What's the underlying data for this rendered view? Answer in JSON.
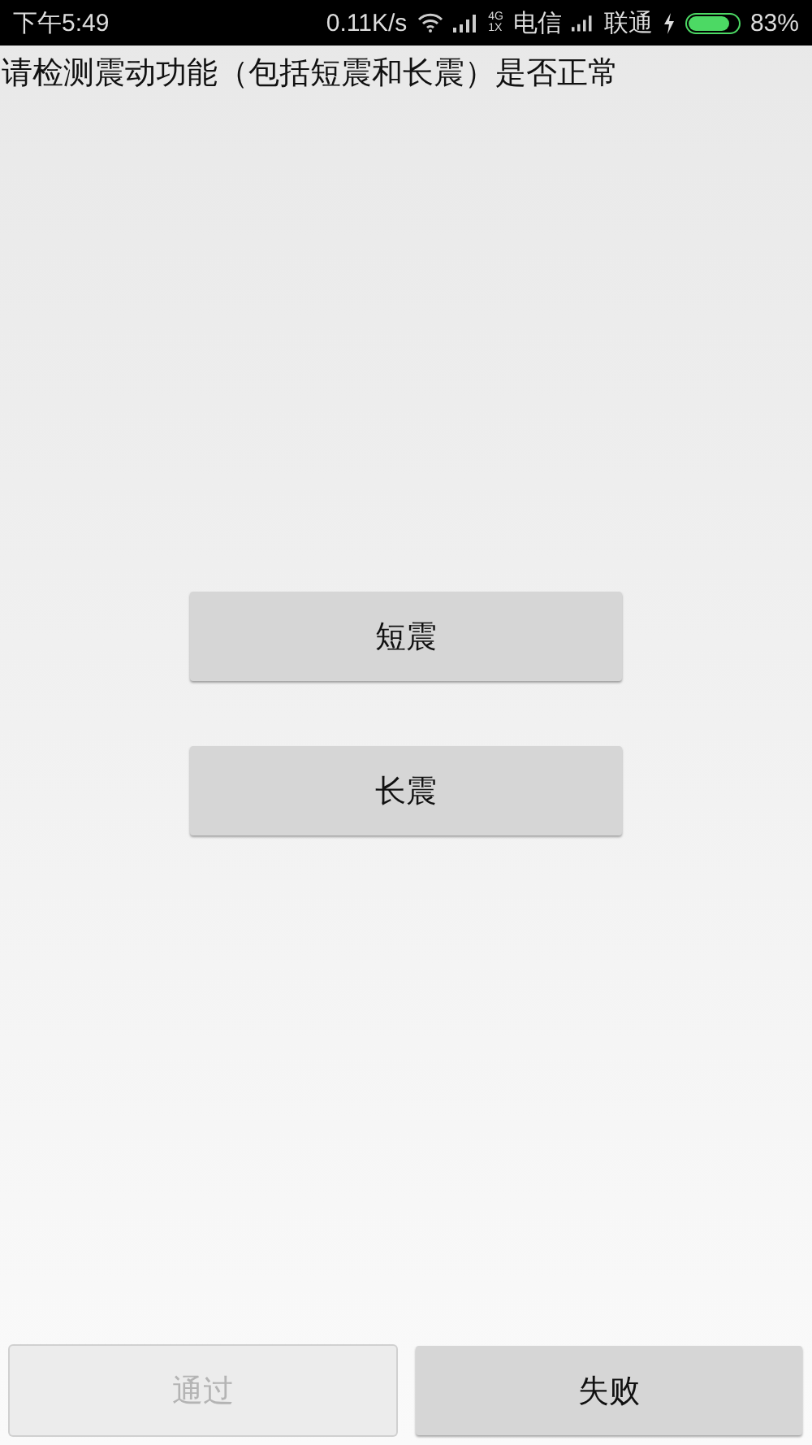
{
  "status_bar": {
    "time": "下午5:49",
    "speed": "0.11K/s",
    "network_type_top": "4G",
    "network_type_bottom": "1X",
    "carrier_1": "电信",
    "carrier_2": "联通",
    "battery": "83%"
  },
  "prompt": "请检测震动功能（包括短震和长震）是否正常",
  "test_buttons": [
    {
      "label": "短震",
      "disabled": false
    },
    {
      "label": "长震",
      "disabled": false
    }
  ],
  "result_buttons": [
    {
      "label": "通过",
      "disabled": true
    },
    {
      "label": "失败",
      "disabled": false
    }
  ]
}
